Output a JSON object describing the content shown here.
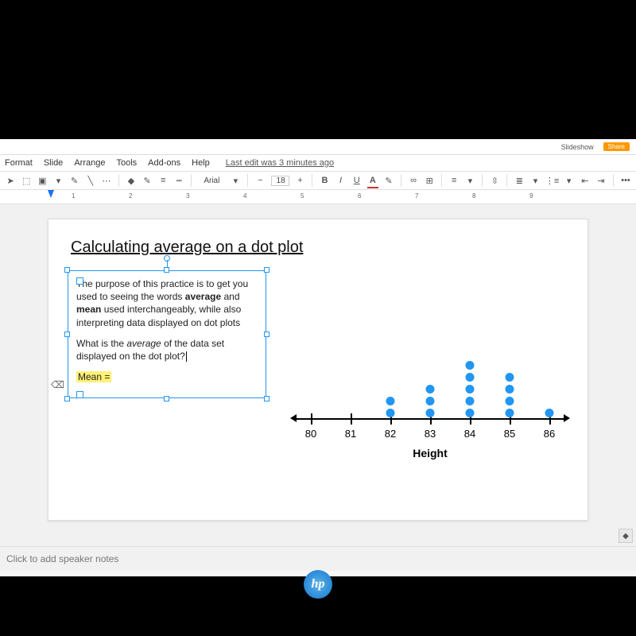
{
  "topbar": {
    "slideshow": "Slideshow",
    "share": "Share"
  },
  "menu": {
    "items": [
      "Format",
      "Slide",
      "Arrange",
      "Tools",
      "Add-ons",
      "Help"
    ],
    "last_edit": "Last edit was 3 minutes ago"
  },
  "toolbar": {
    "font": "Arial",
    "font_size": "18",
    "bold": "B",
    "italic": "I",
    "underline": "U",
    "textcolor": "A",
    "more": "•••"
  },
  "ruler": {
    "marks": [
      "1",
      "2",
      "3",
      "4",
      "5",
      "6",
      "7",
      "8",
      "9"
    ]
  },
  "slide": {
    "title": "Calculating average on a dot plot",
    "para1_a": "The purpose of this practice is to get you used to seeing the words ",
    "para1_b": "average",
    "para1_c": " and ",
    "para1_d": "mean",
    "para1_e": " used interchangeably, while also interpreting data displayed on dot plots",
    "para2_a": "What is the ",
    "para2_b": "average",
    "para2_c": " of the data set displayed on the dot plot?",
    "mean_label": "Mean ="
  },
  "chart_data": {
    "type": "dotplot",
    "title": "",
    "xlabel": "Height",
    "x_ticks": [
      80,
      81,
      82,
      83,
      84,
      85,
      86
    ],
    "counts": {
      "80": 0,
      "81": 0,
      "82": 2,
      "83": 3,
      "84": 5,
      "85": 4,
      "86": 1
    },
    "xlim": [
      80,
      86
    ]
  },
  "speaker_notes": "Click to add speaker notes",
  "logo": "hp"
}
